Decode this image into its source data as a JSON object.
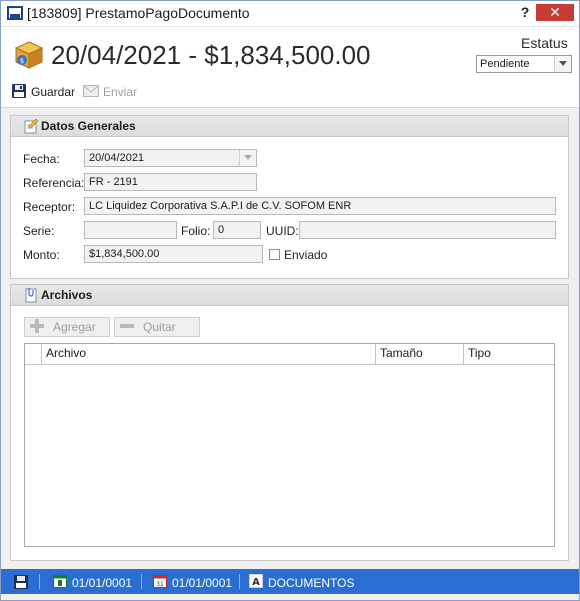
{
  "window": {
    "title": "[183809] PrestamoPagoDocumento",
    "help_label": "?",
    "close_label": "✕"
  },
  "header": {
    "title": "20/04/2021 - $1,834,500.00",
    "status_label": "Estatus",
    "status_value": "Pendiente"
  },
  "toolbar": {
    "save_label": "Guardar",
    "send_label": "Enviar"
  },
  "datos": {
    "title": "Datos Generales",
    "fecha_label": "Fecha:",
    "fecha_value": "20/04/2021",
    "referencia_label": "Referencia:",
    "referencia_value": "FR - 2191",
    "receptor_label": "Receptor:",
    "receptor_value": "LC Liquidez Corporativa S.A.P.I de C.V. SOFOM ENR",
    "serie_label": "Serie:",
    "serie_value": "",
    "folio_label": "Folio:",
    "folio_value": "0",
    "uuid_label": "UUID:",
    "uuid_value": "",
    "monto_label": "Monto:",
    "monto_value": "$1,834,500.00",
    "enviado_label": "Enviado",
    "enviado_checked": false
  },
  "archivos": {
    "title": "Archivos",
    "add_label": "Agregar",
    "remove_label": "Quitar",
    "columns": [
      "Archivo",
      "Tamaño",
      "Tipo"
    ],
    "rows": []
  },
  "statusbar": {
    "date1": "01/01/0001",
    "date2": "01/01/0001",
    "section": "DOCUMENTOS"
  },
  "colors": {
    "statusbar": "#2a6dd3",
    "close_button": "#c73b34",
    "group_header": "#e2e2e2"
  }
}
